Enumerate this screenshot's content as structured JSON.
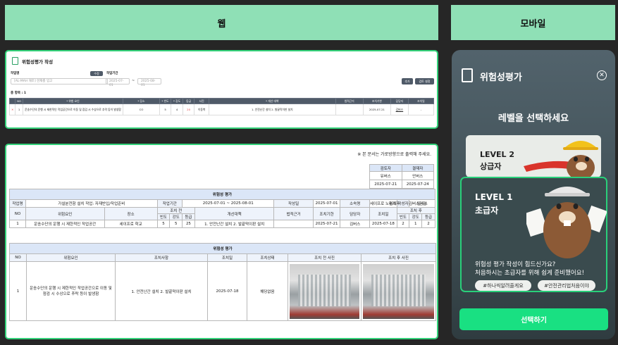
{
  "headers": {
    "web": "웹",
    "mobile": "모바일"
  },
  "form": {
    "title": "위험성평가 작성",
    "workname_label": "작업명",
    "workname_placeholder": "[AL-MAH 재조] 현재를 입고",
    "edit_button": "수정",
    "period_label": "작업기간",
    "date_from": "2025-07-01",
    "date_sep": "~",
    "date_to": "2025-08-01",
    "add_button": "추가",
    "settings_button": "검토 설정",
    "total_label": "총 항목 : 1",
    "columns": [
      "",
      "NO",
      "* 위험 요인",
      "* 장소",
      "* 빈도",
      "* 강도",
      "등급",
      "사진",
      "* 개선 대책",
      "법적근거",
      "조치기한",
      "담당자",
      "조치일"
    ],
    "row": {
      "delete": "✕",
      "no": "1",
      "risk": "운송수단의 운행 시 제한적인 작업공간으로 이동 및 점검 시 수상으로 추락 등이 발생함",
      "place": "CO",
      "freq": "5",
      "sev": "4",
      "grade": "20",
      "photo": "이동복",
      "measure": "1. 안전난간 설치 2. 발끝막이판 설치",
      "legal": "",
      "deadline": "2025-07-21",
      "manager": "김버스",
      "date": "-"
    }
  },
  "doc": {
    "notice": "※ 본 문서는 가로방향으로 출력해 주세요.",
    "approval": {
      "reviewer": "검토자",
      "approver": "결재자",
      "reviewer_name": "유버스",
      "approver_name": "안버스",
      "reviewer_date": "2025-07-21",
      "approver_date": "2025-07-24"
    },
    "section1_title": "위험성 평가",
    "info": {
      "l_work": "작업명",
      "v_work": "가설분전함 설치 작업: 자재반입/작업준비",
      "l_period": "작업기간",
      "v_period": "2025-07-01 ~ 2025-08-01",
      "l_date": "작성일",
      "v_date": "2025-07-01",
      "l_org": "소속명",
      "v_org": "세이프로 노버스페이",
      "l_author": "작성자",
      "v_author": "김버스",
      "l_approver": "결재자",
      "v_approver": "김버스김김"
    },
    "t1_cols": {
      "no": "NO",
      "risk": "위험요인",
      "place": "장소",
      "before": "조치 전",
      "freq": "빈도",
      "sev": "강도",
      "grade": "등급",
      "measure": "개선대책",
      "legal": "법적근거",
      "deadline": "조치기한",
      "manager": "담당자",
      "date": "조치일",
      "after": "조치 후",
      "freq2": "빈도",
      "sev2": "강도",
      "grade2": "등급"
    },
    "t1_row": {
      "no": "1",
      "risk": "운송수단의 운행 시 제한적인 작업공간",
      "place": "세이프로 학교",
      "freq": "5",
      "sev": "5",
      "grade": "25",
      "measure": "1. 안전난간 설치 2. 발끝막이판 설치",
      "legal": "",
      "deadline": "2025-07-21",
      "manager": "김버스",
      "date": "2025-07-18",
      "freq2": "2",
      "sev2": "1",
      "grade2": "2"
    },
    "section2_title": "위험성 평가",
    "t2_cols": {
      "no": "NO",
      "risk": "위험요인",
      "action": "조치사항",
      "date": "조치일",
      "status": "조치상태",
      "before_photo": "조치 전 사진",
      "after_photo": "조치 후 사진"
    },
    "t2_row": {
      "no": "1",
      "risk": "운송수단의 운행 시 제한적인 작업공간으로 이동 및 점검 시 수상으로 추락 등이 발생함",
      "action": "1. 안전난간 설치 2. 발끝막이판 설치",
      "date": "2025-07-18",
      "status": "해당없음"
    }
  },
  "mobile": {
    "title": "위험성평가",
    "subtitle": "레벨을 선택하세요",
    "level2": {
      "level": "LEVEL 2",
      "name": "상급자"
    },
    "level1": {
      "level": "LEVEL 1",
      "name": "초급자",
      "desc1": "위험성 평가 작성이 힘드신가요?",
      "desc2": "처음하시는 초급자를 위해 쉽게 준비했어요!",
      "tag1": "#하나씩알려줄게요",
      "tag2": "#안전관리법처음이야"
    },
    "select_button": "선택하기"
  },
  "colors": {
    "accent": "#34d27a",
    "header_bg": "#8fe0b6",
    "table_head": "#4f5a68",
    "doc_blue": "#dbe6f7"
  }
}
